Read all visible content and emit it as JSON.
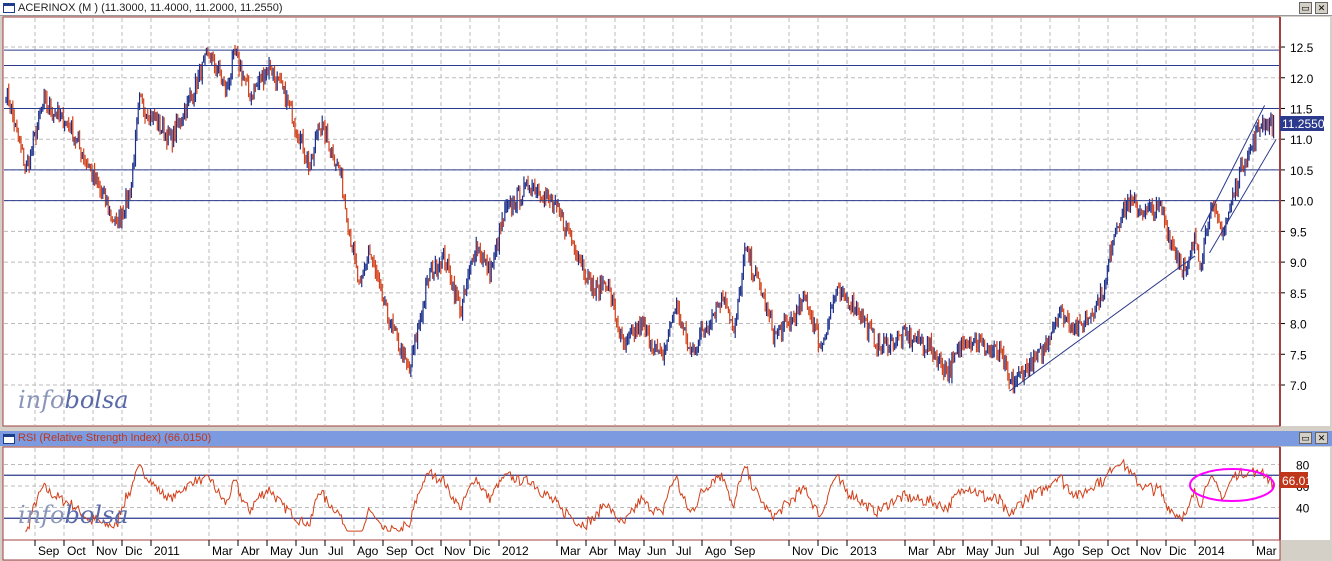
{
  "window": {
    "title": "ACERINOX (M ) (11.3000, 11.4000, 11.2000, 11.2550)",
    "restore_label": "▭",
    "close_label": "✕"
  },
  "rsi_panel": {
    "title": "RSI (Relative Strength Index) (66.0150)",
    "restore_label": "▭",
    "close_label": "✕",
    "current_label": "66.01"
  },
  "watermark": {
    "part1": "info",
    "part2": "bolsa"
  },
  "colors": {
    "up": "#1c2f8a",
    "down": "#d2401a",
    "rsi": "#d2401a",
    "hline": "#2b3a8c",
    "ellipse": "#ff00ff",
    "axis": "#a04040"
  },
  "chart_data": [
    {
      "type": "line",
      "title": "ACERINOX (M )",
      "series_kind": "ohlc-bars",
      "ylim": [
        6.5,
        12.9
      ],
      "yticks": [
        "12.5",
        "12.0",
        "11.5",
        "11.0",
        "10.5",
        "10.0",
        "9.5",
        "9.0",
        "8.5",
        "8.0",
        "7.5",
        "7.0"
      ],
      "ytick_values": [
        12.5,
        12.0,
        11.5,
        11.0,
        10.5,
        10.0,
        9.5,
        9.0,
        8.5,
        8.0,
        7.5,
        7.0
      ],
      "last_value_label": "11.2550",
      "hlines": [
        12.45,
        12.2,
        11.5,
        10.5,
        10.0
      ],
      "trendlines": [
        [
          [
            34.6,
            6.9
          ],
          [
            41.0,
            9.1
          ]
        ],
        [
          [
            41.2,
            9.5
          ],
          [
            43.4,
            11.55
          ]
        ],
        [
          [
            41.5,
            9.15
          ],
          [
            43.8,
            11.0
          ]
        ]
      ],
      "x_unit": "months since Aug 2010",
      "close_path": [
        [
          0,
          11.8
        ],
        [
          0.7,
          10.5
        ],
        [
          1.3,
          11.6
        ],
        [
          2.2,
          11.2
        ],
        [
          2.9,
          10.5
        ],
        [
          3.8,
          9.6
        ],
        [
          4.3,
          10.2
        ],
        [
          4.6,
          11.6
        ],
        [
          5.7,
          11.0
        ],
        [
          6.2,
          11.5
        ],
        [
          7.0,
          12.4
        ],
        [
          7.6,
          11.8
        ],
        [
          7.9,
          12.4
        ],
        [
          8.4,
          11.7
        ],
        [
          9.1,
          12.2
        ],
        [
          9.8,
          11.5
        ],
        [
          10.5,
          10.5
        ],
        [
          10.8,
          11.3
        ],
        [
          11.5,
          10.5
        ],
        [
          12.2,
          8.5
        ],
        [
          12.5,
          9.2
        ],
        [
          13.1,
          8.2
        ],
        [
          13.9,
          7.2
        ],
        [
          14.6,
          8.8
        ],
        [
          15.1,
          9.1
        ],
        [
          15.7,
          8.2
        ],
        [
          16.2,
          9.3
        ],
        [
          16.7,
          8.8
        ],
        [
          17.2,
          9.8
        ],
        [
          18.1,
          10.3
        ],
        [
          18.9,
          9.9
        ],
        [
          19.4,
          9.5
        ],
        [
          20.3,
          8.5
        ],
        [
          20.7,
          8.7
        ],
        [
          21.3,
          7.6
        ],
        [
          21.9,
          8.0
        ],
        [
          22.6,
          7.4
        ],
        [
          23.1,
          8.3
        ],
        [
          23.6,
          7.5
        ],
        [
          24.4,
          8.2
        ],
        [
          24.8,
          8.5
        ],
        [
          25.1,
          7.8
        ],
        [
          25.5,
          9.2
        ],
        [
          26.0,
          8.6
        ],
        [
          26.5,
          7.8
        ],
        [
          27.0,
          8.0
        ],
        [
          27.6,
          8.4
        ],
        [
          28.1,
          7.6
        ],
        [
          28.6,
          8.5
        ],
        [
          29.3,
          8.3
        ],
        [
          30.1,
          7.6
        ],
        [
          31.0,
          7.8
        ],
        [
          31.9,
          7.6
        ],
        [
          32.5,
          7.2
        ],
        [
          33.1,
          7.8
        ],
        [
          33.8,
          7.6
        ],
        [
          34.3,
          7.5
        ],
        [
          34.6,
          7.0
        ],
        [
          35.7,
          7.5
        ],
        [
          36.3,
          8.2
        ],
        [
          37.0,
          7.9
        ],
        [
          37.6,
          8.3
        ],
        [
          37.9,
          8.6
        ],
        [
          38.2,
          9.5
        ],
        [
          38.7,
          10.0
        ],
        [
          39.3,
          9.8
        ],
        [
          39.8,
          9.9
        ],
        [
          40.3,
          9.2
        ],
        [
          40.7,
          8.8
        ],
        [
          41.0,
          9.4
        ],
        [
          41.2,
          9.0
        ],
        [
          41.5,
          9.9
        ],
        [
          42.0,
          9.5
        ],
        [
          42.6,
          10.6
        ],
        [
          42.9,
          10.8
        ],
        [
          43.3,
          11.3
        ],
        [
          43.7,
          11.255
        ]
      ]
    },
    {
      "type": "line",
      "title": "RSI (Relative Strength Index)",
      "ylim": [
        10,
        95
      ],
      "yticks": [
        "80",
        "60",
        "40"
      ],
      "ytick_values": [
        80,
        60,
        40
      ],
      "hlines": [
        70,
        30
      ],
      "last_value": 66.015,
      "annotation": "ellipse around Jan–Mar 2014"
    }
  ],
  "x_axis": {
    "ticks": [
      [
        "Sep",
        1
      ],
      [
        "Oct",
        2
      ],
      [
        "Nov",
        3
      ],
      [
        "Dic",
        4
      ],
      [
        "2011",
        5
      ],
      [
        "Mar",
        7
      ],
      [
        "Abr",
        8
      ],
      [
        "May",
        9
      ],
      [
        "Jun",
        10
      ],
      [
        "Jul",
        11
      ],
      [
        "Ago",
        12
      ],
      [
        "Sep",
        13
      ],
      [
        "Oct",
        14
      ],
      [
        "Nov",
        15
      ],
      [
        "Dic",
        16
      ],
      [
        "2012",
        17
      ],
      [
        "Mar",
        19
      ],
      [
        "Abr",
        20
      ],
      [
        "May",
        21
      ],
      [
        "Jun",
        22
      ],
      [
        "Jul",
        23
      ],
      [
        "Ago",
        24
      ],
      [
        "Sep",
        25
      ],
      [
        "Nov",
        27
      ],
      [
        "Dic",
        28
      ],
      [
        "2013",
        29
      ],
      [
        "Mar",
        31
      ],
      [
        "Abr",
        32
      ],
      [
        "May",
        33
      ],
      [
        "Jun",
        34
      ],
      [
        "Jul",
        35
      ],
      [
        "Ago",
        36
      ],
      [
        "Sep",
        37
      ],
      [
        "Oct",
        38
      ],
      [
        "Nov",
        39
      ],
      [
        "Dic",
        40
      ],
      [
        "2014",
        41
      ],
      [
        "Mar",
        43
      ]
    ]
  }
}
